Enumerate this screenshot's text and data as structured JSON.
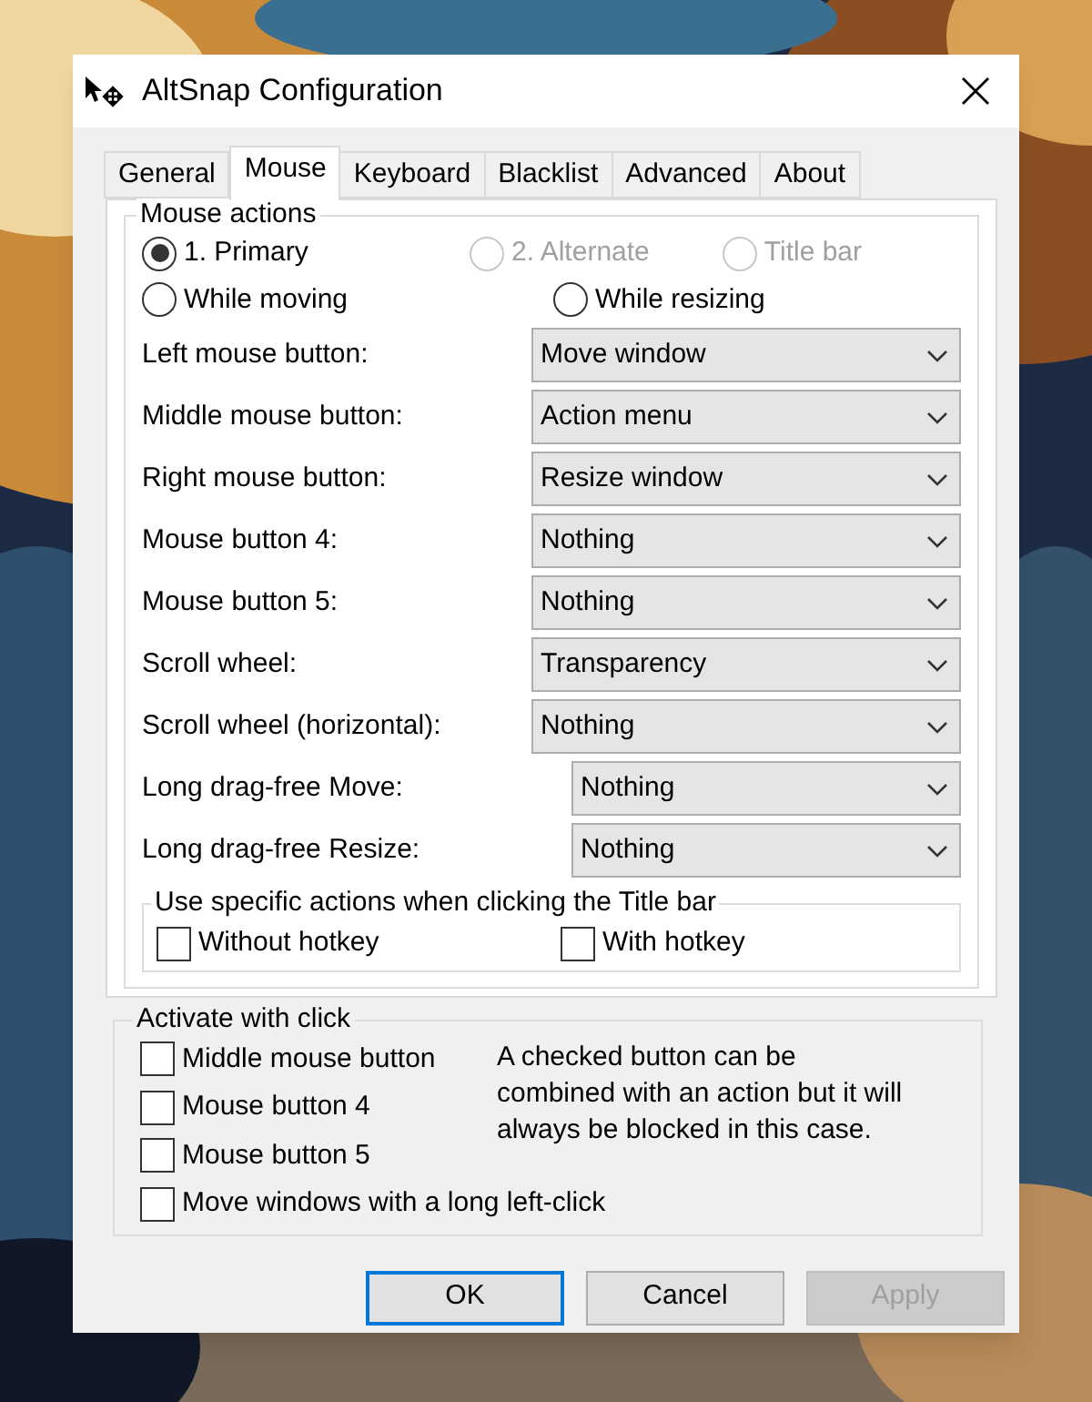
{
  "window": {
    "title": "AltSnap Configuration"
  },
  "tabs": [
    {
      "label": "General",
      "selected": false
    },
    {
      "label": "Mouse",
      "selected": true
    },
    {
      "label": "Keyboard",
      "selected": false
    },
    {
      "label": "Blacklist",
      "selected": false
    },
    {
      "label": "Advanced",
      "selected": false
    },
    {
      "label": "About",
      "selected": false
    }
  ],
  "mouse_actions": {
    "title": "Mouse actions",
    "modes": [
      {
        "label": "1. Primary",
        "selected": true,
        "disabled": false
      },
      {
        "label": "2. Alternate",
        "selected": false,
        "disabled": true
      },
      {
        "label": "Title bar",
        "selected": false,
        "disabled": true
      }
    ],
    "phases": [
      {
        "label": "While moving",
        "selected": false
      },
      {
        "label": "While resizing",
        "selected": false
      }
    ],
    "rows": [
      {
        "label": "Left mouse button:",
        "value": "Move window",
        "kind": "wide"
      },
      {
        "label": "Middle mouse button:",
        "value": "Action menu",
        "kind": "wide"
      },
      {
        "label": "Right mouse button:",
        "value": "Resize window",
        "kind": "wide"
      },
      {
        "label": "Mouse button 4:",
        "value": "Nothing",
        "kind": "wide"
      },
      {
        "label": "Mouse button 5:",
        "value": "Nothing",
        "kind": "wide"
      },
      {
        "label": "Scroll wheel:",
        "value": "Transparency",
        "kind": "wide"
      },
      {
        "label": "Scroll wheel (horizontal):",
        "value": "Nothing",
        "kind": "wide"
      },
      {
        "label": "Long drag-free Move:",
        "value": "Nothing",
        "kind": "narrow"
      },
      {
        "label": "Long drag-free Resize:",
        "value": "Nothing",
        "kind": "narrow"
      }
    ],
    "title_bar": {
      "title": "Use specific actions when clicking the Title bar",
      "options": [
        {
          "label": "Without hotkey",
          "checked": false
        },
        {
          "label": "With hotkey",
          "checked": false
        }
      ]
    }
  },
  "activate": {
    "title": "Activate with click",
    "options": [
      {
        "label": "Middle mouse button",
        "checked": false
      },
      {
        "label": "Mouse button 4",
        "checked": false
      },
      {
        "label": "Mouse button 5",
        "checked": false
      },
      {
        "label": "Move windows with a long left-click",
        "checked": false
      }
    ],
    "note": "A checked button can be combined with an action but it will always be blocked in this case."
  },
  "buttons": [
    {
      "label": "OK",
      "default": true,
      "disabled": false
    },
    {
      "label": "Cancel",
      "default": false,
      "disabled": false
    },
    {
      "label": "Apply",
      "default": false,
      "disabled": true
    }
  ]
}
